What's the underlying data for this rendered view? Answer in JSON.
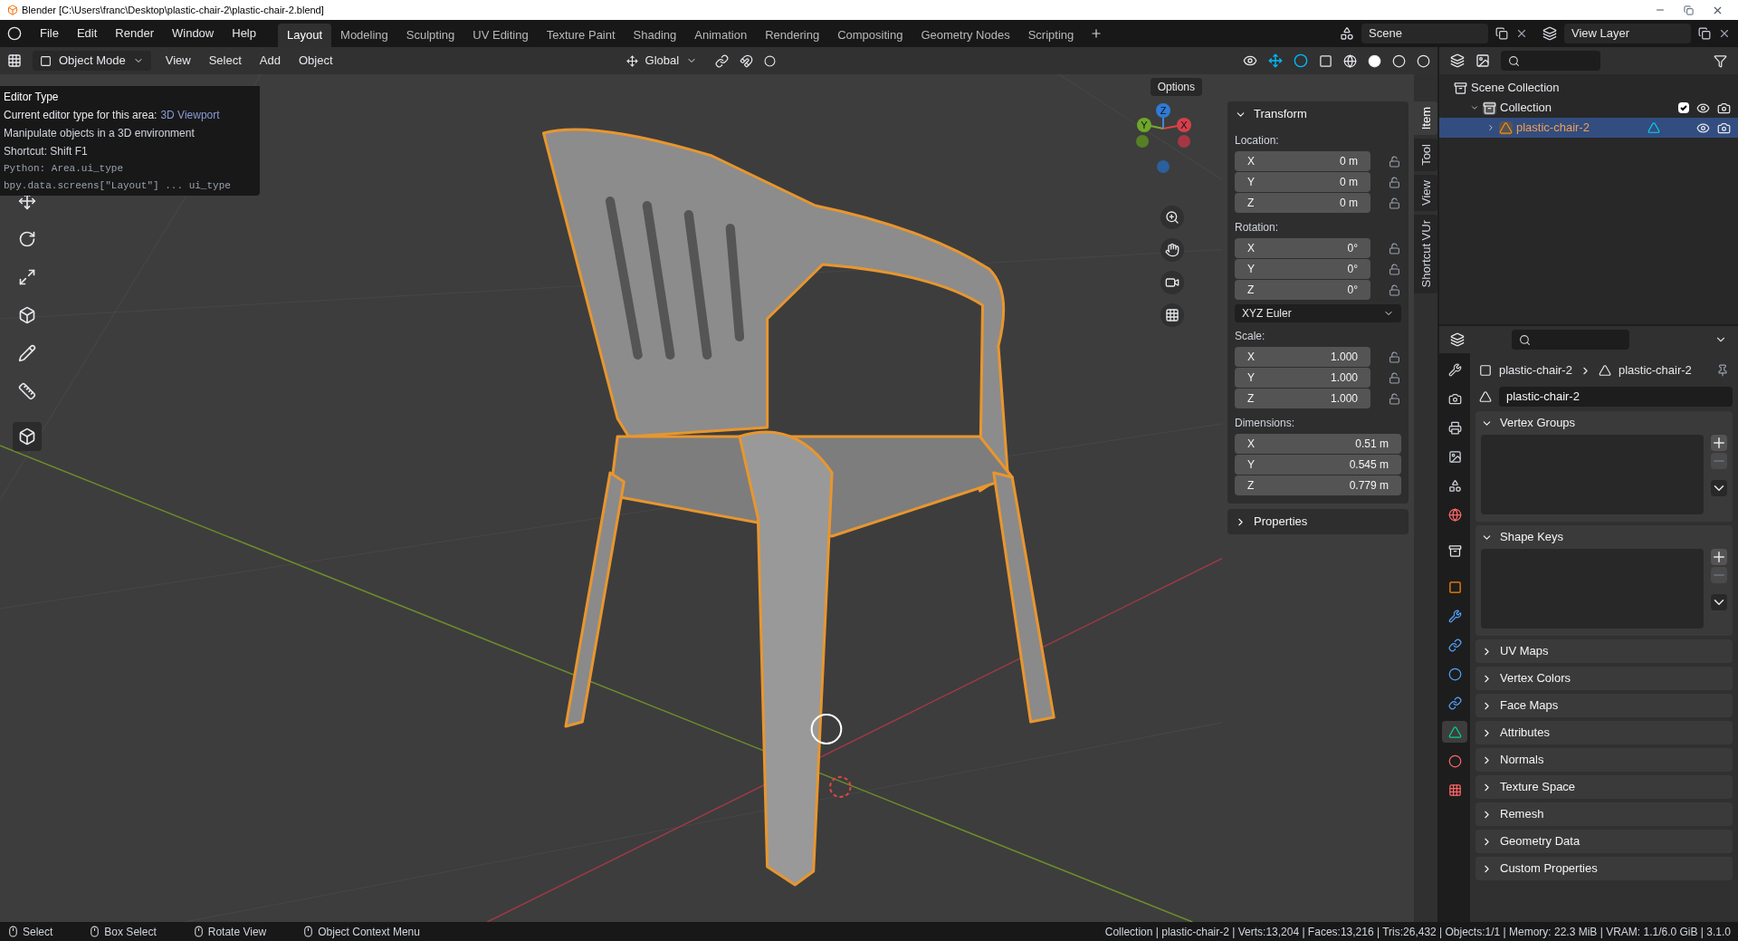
{
  "window": {
    "title": "Blender [C:\\Users\\franc\\Desktop\\plastic-chair-2\\plastic-chair-2.blend]"
  },
  "menu": [
    "File",
    "Edit",
    "Render",
    "Window",
    "Help"
  ],
  "workspaces": [
    {
      "label": "Layout",
      "selected": true
    },
    {
      "label": "Modeling",
      "selected": false
    },
    {
      "label": "Sculpting",
      "selected": false
    },
    {
      "label": "UV Editing",
      "selected": false
    },
    {
      "label": "Texture Paint",
      "selected": false
    },
    {
      "label": "Shading",
      "selected": false
    },
    {
      "label": "Animation",
      "selected": false
    },
    {
      "label": "Rendering",
      "selected": false
    },
    {
      "label": "Compositing",
      "selected": false
    },
    {
      "label": "Geometry Nodes",
      "selected": false
    },
    {
      "label": "Scripting",
      "selected": false
    }
  ],
  "scene": "Scene",
  "view_layer": "View Layer",
  "viewport_header": {
    "mode": "Object Mode",
    "menus": [
      "View",
      "Select",
      "Add",
      "Object"
    ],
    "orientation": "Global",
    "options": "Options"
  },
  "tooltip": {
    "title": "Editor Type",
    "desc_label": "Current editor type for this area:",
    "desc_value": "3D Viewport",
    "lines": [
      "Manipulate objects in a 3D environment",
      "Shortcut: Shift F1"
    ],
    "python": [
      "Python: Area.ui_type",
      "bpy.data.screens[\"Layout\"] ... ui_type"
    ]
  },
  "gizmo": {
    "x": "X",
    "y": "Y",
    "z": "Z"
  },
  "sidebar": {
    "tabs": [
      {
        "label": "Item",
        "selected": true
      },
      {
        "label": "Tool",
        "selected": false
      },
      {
        "label": "View",
        "selected": false
      },
      {
        "label": "Shortcut VUr",
        "selected": false
      }
    ],
    "panel": {
      "label": "Transform",
      "expanded": true
    },
    "groups": [
      {
        "kind": "fields",
        "label": "Location:",
        "locks": true,
        "fields": [
          {
            "axis": "X",
            "value": "0 m"
          },
          {
            "axis": "Y",
            "value": "0 m"
          },
          {
            "axis": "Z",
            "value": "0 m"
          }
        ]
      },
      {
        "kind": "fields",
        "label": "Rotation:",
        "locks": true,
        "fields": [
          {
            "axis": "X",
            "value": "0°"
          },
          {
            "axis": "Y",
            "value": "0°"
          },
          {
            "axis": "Z",
            "value": "0°"
          }
        ]
      },
      {
        "kind": "dropdown",
        "value": "XYZ Euler"
      },
      {
        "kind": "fields",
        "label": "Scale:",
        "locks": true,
        "fields": [
          {
            "axis": "X",
            "value": "1.000"
          },
          {
            "axis": "Y",
            "value": "1.000"
          },
          {
            "axis": "Z",
            "value": "1.000"
          }
        ]
      },
      {
        "kind": "fields",
        "label": "Dimensions:",
        "locks": false,
        "fields": [
          {
            "axis": "X",
            "value": "0.51 m"
          },
          {
            "axis": "Y",
            "value": "0.545 m"
          },
          {
            "axis": "Z",
            "value": "0.779 m"
          }
        ]
      }
    ],
    "collapsed_panel": {
      "label": "Properties",
      "expanded": false
    }
  },
  "outliner": {
    "items": [
      {
        "label": "Scene Collection",
        "kind": "scene_collection",
        "selected": false,
        "children": [
          {
            "label": "Collection",
            "kind": "collection",
            "selected": false,
            "expanded": true,
            "checked": true,
            "children": [
              {
                "label": "plastic-chair-2",
                "kind": "mesh",
                "selected": true,
                "expanded": false
              }
            ]
          }
        ]
      }
    ]
  },
  "properties": {
    "tabs": [
      {
        "kind": "tool",
        "selected": false
      },
      {
        "kind": "render",
        "selected": false
      },
      {
        "kind": "output",
        "selected": false
      },
      {
        "kind": "view_layer",
        "selected": false
      },
      {
        "kind": "scene",
        "selected": false
      },
      {
        "kind": "world",
        "selected": false
      },
      {
        "kind": "collection",
        "selected": false
      },
      {
        "kind": "object",
        "selected": false
      },
      {
        "kind": "modifiers",
        "selected": false
      },
      {
        "kind": "particles",
        "selected": false
      },
      {
        "kind": "physics",
        "selected": false
      },
      {
        "kind": "constraints",
        "selected": false
      },
      {
        "kind": "data",
        "selected": true
      },
      {
        "kind": "material",
        "selected": false
      },
      {
        "kind": "texture",
        "selected": false
      }
    ],
    "breadcrumb": [
      "plastic-chair-2",
      "plastic-chair-2"
    ],
    "data_name": "plastic-chair-2",
    "panels": [
      {
        "label": "Vertex Groups",
        "expanded": true
      },
      {
        "label": "Shape Keys",
        "expanded": true
      },
      {
        "label": "UV Maps",
        "expanded": false
      },
      {
        "label": "Vertex Colors",
        "expanded": false
      },
      {
        "label": "Face Maps",
        "expanded": false
      },
      {
        "label": "Attributes",
        "expanded": false
      },
      {
        "label": "Normals",
        "expanded": false
      },
      {
        "label": "Texture Space",
        "expanded": false
      },
      {
        "label": "Remesh",
        "expanded": false
      },
      {
        "label": "Geometry Data",
        "expanded": false
      },
      {
        "label": "Custom Properties",
        "expanded": false
      }
    ]
  },
  "status_bar": {
    "hints": [
      "Select",
      "Box Select",
      "Rotate View",
      "Object Context Menu"
    ],
    "stats": "Collection | plastic-chair-2 | Verts:13,204 | Faces:13,216 | Tris:26,432 | Objects:1/1 | Memory: 22.3 MiB | VRAM: 1.1/6.0 GiB | 3.1.0"
  }
}
